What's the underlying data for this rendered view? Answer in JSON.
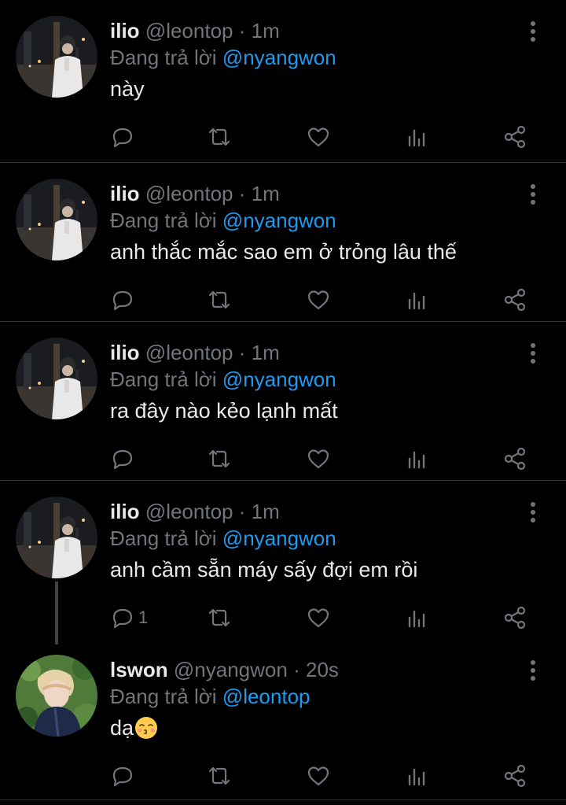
{
  "tweets": [
    {
      "name": "ilio",
      "handle": "@leontop",
      "separator": "·",
      "time": "1m",
      "reply_prefix": "Đang trả lời",
      "reply_mention": "@nyangwon",
      "text": "này",
      "reply_count": ""
    },
    {
      "name": "ilio",
      "handle": "@leontop",
      "separator": "·",
      "time": "1m",
      "reply_prefix": "Đang trả lời",
      "reply_mention": "@nyangwon",
      "text": "anh thắc mắc sao em ở trỏng lâu thế",
      "reply_count": ""
    },
    {
      "name": "ilio",
      "handle": "@leontop",
      "separator": "·",
      "time": "1m",
      "reply_prefix": "Đang trả lời",
      "reply_mention": "@nyangwon",
      "text": "ra đây nào kẻo lạnh mất",
      "reply_count": ""
    },
    {
      "name": "ilio",
      "handle": "@leontop",
      "separator": "·",
      "time": "1m",
      "reply_prefix": "Đang trả lời",
      "reply_mention": "@nyangwon",
      "text": "anh cầm sẵn máy sấy đợi em rồi",
      "reply_count": "1"
    },
    {
      "name": "lswon",
      "handle": "@nyangwon",
      "separator": "·",
      "time": "20s",
      "reply_prefix": "Đang trả lời",
      "reply_mention": "@leontop",
      "text": "dạ",
      "emoji": "kissing-face-emoji",
      "reply_count": ""
    }
  ],
  "icons": {
    "reply": "reply-icon",
    "retweet": "retweet-icon",
    "like": "heart-icon",
    "stats": "stats-icon",
    "share": "share-icon",
    "more": "more-vertical-icon"
  },
  "colors": {
    "background": "#000000",
    "text": "#e7e9ea",
    "muted": "#71767b",
    "link": "#1d9bf0",
    "divider": "#2f3336"
  }
}
